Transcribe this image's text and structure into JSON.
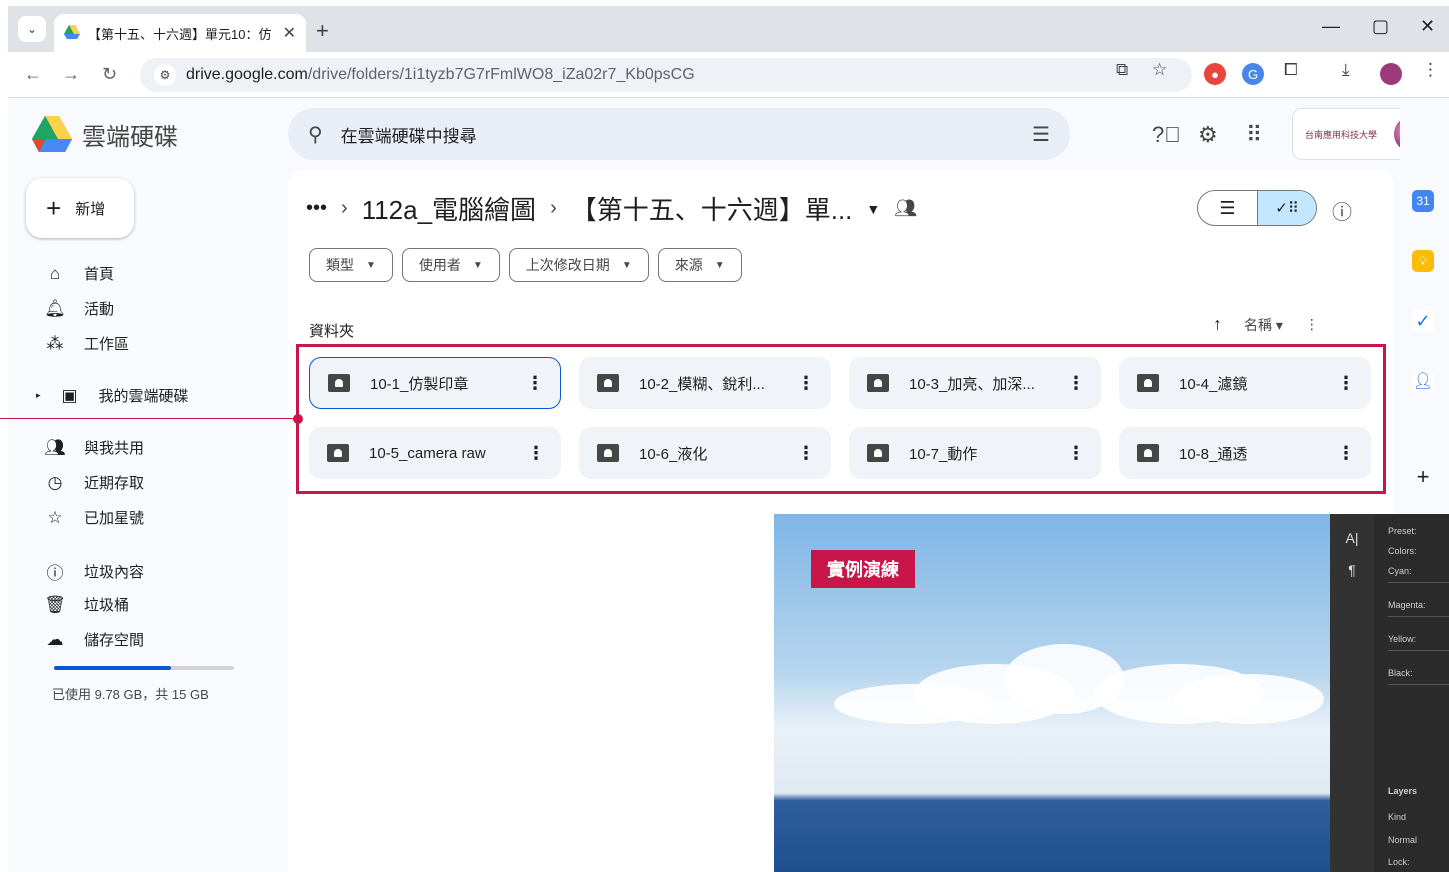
{
  "browser": {
    "tab_title": "【第十五、十六週】單元10：仿",
    "url_host": "drive.google.com",
    "url_path": "/drive/folders/1i1tyzb7G7rFmlWO8_iZa02r7_Kb0psCG"
  },
  "app": {
    "name": "雲端硬碟"
  },
  "search": {
    "placeholder": "在雲端硬碟中搜尋"
  },
  "account": {
    "org": "台南應用科技大學"
  },
  "sidebar": {
    "new_label": "新增",
    "items": [
      {
        "label": "首頁",
        "icon": "home-icon"
      },
      {
        "label": "活動",
        "icon": "bell-icon"
      },
      {
        "label": "工作區",
        "icon": "workspace-icon"
      },
      {
        "label": "我的雲端硬碟",
        "icon": "my-drive-icon"
      },
      {
        "label": "與我共用",
        "icon": "people-icon"
      },
      {
        "label": "近期存取",
        "icon": "clock-icon"
      },
      {
        "label": "已加星號",
        "icon": "star-icon"
      },
      {
        "label": "垃圾內容",
        "icon": "spam-icon"
      },
      {
        "label": "垃圾桶",
        "icon": "trash-icon"
      },
      {
        "label": "儲存空間",
        "icon": "cloud-icon"
      }
    ],
    "storage_text": "已使用 9.78 GB，共 15 GB",
    "storage_fraction": 0.652
  },
  "breadcrumb": {
    "more": "•••",
    "parent": "112a_電腦繪圖",
    "current": "【第十五、十六週】單..."
  },
  "filters": [
    "類型",
    "使用者",
    "上次修改日期",
    "來源"
  ],
  "section": {
    "label": "資料夾",
    "sort_label": "名稱"
  },
  "folders": [
    "10-1_仿製印章",
    "10-2_模糊、銳利...",
    "10-3_加亮、加深...",
    "10-4_濾鏡",
    "10-5_camera raw",
    "10-6_液化",
    "10-7_動作",
    "10-8_通透"
  ],
  "preview": {
    "badge": "實例演練",
    "ps_labels": [
      "Preset:",
      "Colors:",
      "Cyan:",
      "Magenta:",
      "Yellow:",
      "Black:",
      "Layers",
      "Kind",
      "Normal",
      "Lock:"
    ]
  },
  "colors": {
    "accent": "#0b57d0",
    "highlight": "#c8164a"
  }
}
